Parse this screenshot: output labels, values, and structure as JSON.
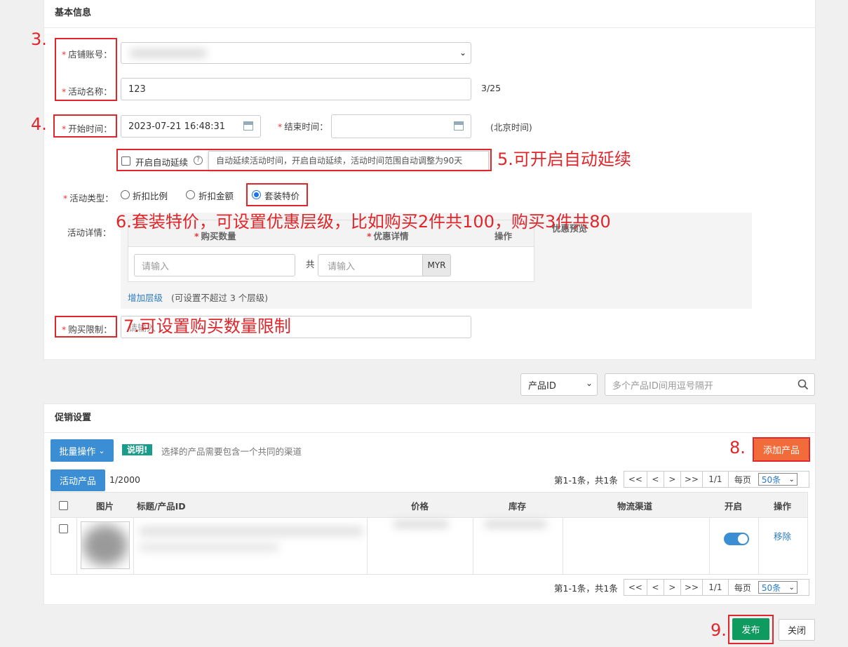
{
  "basic": {
    "title": "基本信息",
    "shop_label": "店铺账号：",
    "name_label": "活动名称：",
    "name_value": "123",
    "name_count": "3/25",
    "start_label": "开始时间：",
    "start_value": "2023-07-21 16:48:31",
    "end_label": "结束时间：",
    "timezone": "(北京时间)",
    "auto_extend_label": "开启自动延续",
    "auto_extend_tip": "自动延续活动时间，开启自动延续，活动时间范围自动调整为90天",
    "type_label": "活动类型：",
    "type_options": [
      "折扣比例",
      "折扣金额",
      "套装特价"
    ],
    "type_selected": "套装特价",
    "detail_label": "活动详情：",
    "detail_headers": [
      "购买数量",
      "优惠详情",
      "操作",
      "优惠预览"
    ],
    "detail_qty_placeholder": "请输入",
    "detail_total_word": "共",
    "detail_price_placeholder": "请输入",
    "currency": "MYR",
    "add_tier": "增加层级",
    "add_tier_note": "(可设置不超过 3 个层级)",
    "limit_label": "购买限制：",
    "limit_placeholder": "请输入"
  },
  "search": {
    "field": "产品ID",
    "placeholder": "多个产品ID间用逗号隔开"
  },
  "promo": {
    "title": "促销设置",
    "batch_button": "批量操作",
    "note_badge": "说明!",
    "note_text": "选择的产品需要包含一个共同的渠道",
    "add_product": "添加产品",
    "tab_label": "活动产品",
    "tab_count": "1/2000",
    "pager_info": "第1-1条，共1条",
    "pager_buttons": [
      "<<",
      "<",
      ">",
      ">>"
    ],
    "pager_page": "1/1",
    "per_page_label": "每页",
    "per_page_value": "50条",
    "columns": [
      "图片",
      "标题/产品ID",
      "价格",
      "库存",
      "物流渠道",
      "开启",
      "操作"
    ],
    "row_action": "移除"
  },
  "footer": {
    "publish": "发布",
    "close": "关闭"
  },
  "annotations": {
    "a3": "3.",
    "a4": "4.",
    "a5": "5.可开启自动延续",
    "a6": "6.套装特价，可设置优惠层级，比如购买2件共100，购买3件共80",
    "a7": "7.可设置购买数量限制",
    "a8": "8.",
    "a9": "9."
  },
  "colors": {
    "annotation_red": "#e0262a",
    "primary_blue": "#3b8ed3",
    "add_orange": "#f26b3a",
    "publish_green": "#0f9a5f",
    "note_teal": "#1a9c8a"
  }
}
